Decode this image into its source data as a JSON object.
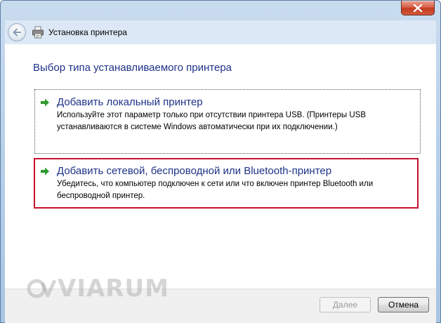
{
  "window": {
    "title": "Установка принтера"
  },
  "content": {
    "heading": "Выбор типа устанавливаемого принтера",
    "options": [
      {
        "title": "Добавить локальный принтер",
        "description": "Используйте этот параметр только при отсутствии принтера USB. (Принтеры USB устанавливаются в системе Windows автоматически при их подключении.)"
      },
      {
        "title": "Добавить сетевой, беспроводной или Bluetooth-принтер",
        "description": "Убедитесь, что компьютер подключен к сети или что включен принтер Bluetooth или беспроводной принтер."
      }
    ]
  },
  "footer": {
    "next_label": "Далее",
    "cancel_label": "Отмена"
  },
  "watermark": {
    "text": "VIARUM"
  },
  "icons": {
    "close": "close-icon",
    "back": "back-arrow-icon",
    "printer": "printer-icon",
    "option_arrow": "green-arrow-icon"
  },
  "colors": {
    "heading": "#1e3287",
    "highlight_border": "#c8102e",
    "arrow": "#2e9a2e"
  }
}
